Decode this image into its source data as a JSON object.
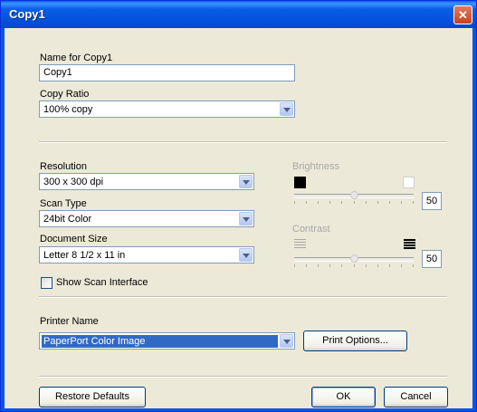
{
  "window": {
    "title": "Copy1",
    "close_glyph": "✕"
  },
  "name_section": {
    "label": "Name for Copy1",
    "value": "Copy1"
  },
  "copy_ratio": {
    "label": "Copy Ratio",
    "value": "100% copy"
  },
  "resolution": {
    "label": "Resolution",
    "value": "300 x 300 dpi"
  },
  "scan_type": {
    "label": "Scan Type",
    "value": "24bit Color"
  },
  "document_size": {
    "label": "Document Size",
    "value": "Letter 8 1/2 x 11 in"
  },
  "show_scan_interface": {
    "label": "Show Scan Interface",
    "checked": false
  },
  "brightness": {
    "label": "Brightness",
    "value": "50",
    "level": 0.5,
    "low_icon": "black-square-icon",
    "high_icon": "white-square-icon"
  },
  "contrast": {
    "label": "Contrast",
    "value": "50",
    "level": 0.5,
    "low_icon": "light-lines-icon",
    "high_icon": "dark-lines-icon"
  },
  "printer": {
    "label": "Printer Name",
    "value": "PaperPort Color Image"
  },
  "buttons": {
    "print_options": "Print Options...",
    "restore_defaults": "Restore Defaults",
    "ok": "OK",
    "cancel": "Cancel"
  },
  "colors": {
    "title_bar": "#0a5fe6",
    "dialog_bg": "#ece9d8",
    "selection": "#316ac5",
    "disabled_text": "#a7a7a7"
  }
}
